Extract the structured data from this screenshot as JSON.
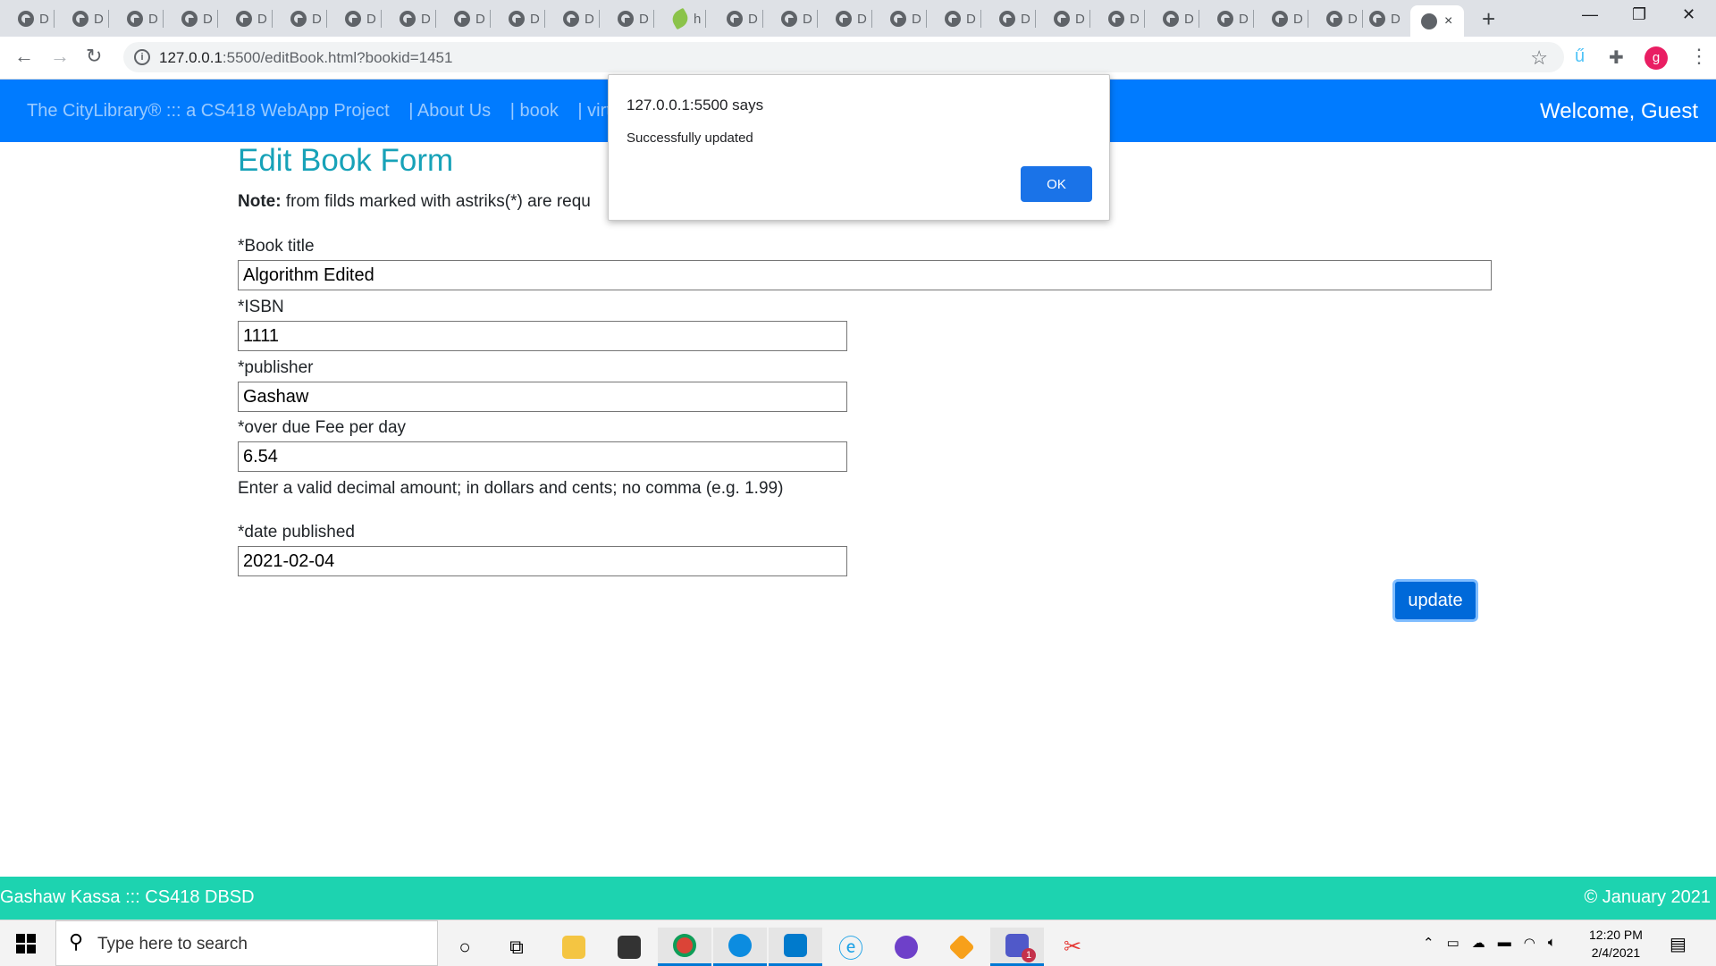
{
  "browser": {
    "tab_letter": "D",
    "leaf_tab_letter": "h",
    "active_tab_close": "×",
    "new_tab": "+",
    "window_controls": [
      "—",
      "❐",
      "✕"
    ],
    "url_host": "127.0.0.1",
    "url_rest": ":5500/editBook.html?bookid=1451",
    "profile_initial": "g",
    "accent": "#007bff"
  },
  "nav": {
    "links": [
      "The CityLibrary® ::: a CS418 WebApp Project",
      "| About Us",
      "| book",
      "| virtu"
    ],
    "welcome": "Welcome, Guest"
  },
  "form": {
    "title": "Edit Book Form",
    "note_bold": "Note:",
    "note_text": " from filds marked with astriks(*) are requ",
    "fields": {
      "title_label": "*Book title",
      "title_value": "Algorithm Edited",
      "isbn_label": "*ISBN",
      "isbn_value": "1111",
      "publisher_label": "*publisher",
      "publisher_value": "Gashaw",
      "fee_label": "*over due Fee per day",
      "fee_value": "6.54",
      "fee_help": "Enter a valid decimal amount; in dollars and cents; no comma (e.g. 1.99)",
      "date_label": "*date published",
      "date_value": "2021-02-04"
    },
    "update_label": "update"
  },
  "footer": {
    "left": "Gashaw Kassa ::: CS418 DBSD",
    "right": "© January 2021"
  },
  "dialog": {
    "origin": "127.0.0.1:5500 says",
    "message": "Successfully updated",
    "ok_label": "OK"
  },
  "taskbar": {
    "search_placeholder": "Type here to search",
    "time": "12:20 PM",
    "date": "2/4/2021",
    "teams_badge": "1"
  }
}
